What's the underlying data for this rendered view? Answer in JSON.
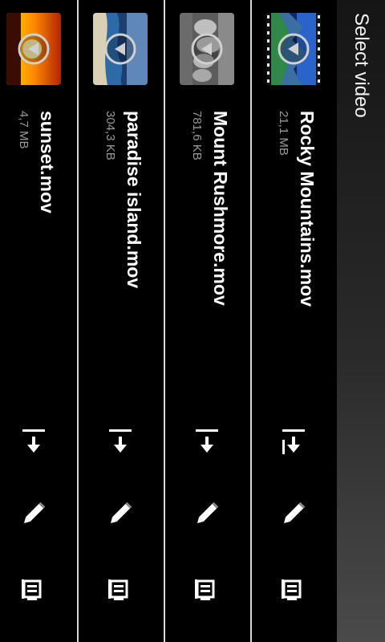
{
  "header": {
    "title": "Select video"
  },
  "videos": [
    {
      "name": "Rocky Mountains.mov",
      "size": "21,1 MB",
      "thumbnail": "rocky-mountains-thumbnail"
    },
    {
      "name": "Mount Rushmore.mov",
      "size": "781,6 KB",
      "thumbnail": "mount-rushmore-thumbnail"
    },
    {
      "name": "paradise island.mov",
      "size": "304,3 KB",
      "thumbnail": "paradise-island-thumbnail"
    },
    {
      "name": "sunset.mov",
      "size": "4,7 MB",
      "thumbnail": "sunset-thumbnail"
    }
  ],
  "icons": {
    "play": "play-icon",
    "share": "share-icon",
    "edit": "pencil-icon",
    "delete": "trash-icon"
  },
  "colors": {
    "background": "#000000",
    "divider": "#d8d8d8",
    "secondary_text": "#9a9a9a"
  }
}
